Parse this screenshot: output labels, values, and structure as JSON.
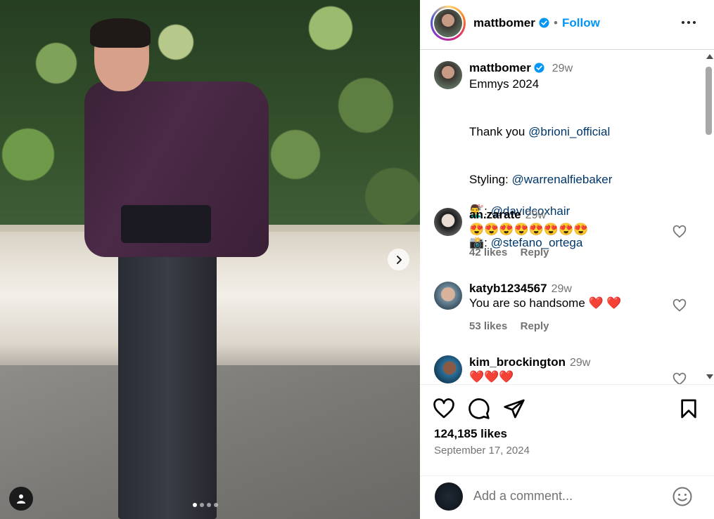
{
  "post": {
    "username": "mattbomer",
    "follow_label": "Follow",
    "separator": "•",
    "verified_color": "#0095f6"
  },
  "media": {
    "carousel_count": 4,
    "active_index": 0
  },
  "caption": {
    "username": "mattbomer",
    "time": "29w",
    "line1": "Emmys 2024",
    "thanks_prefix": "Thank you ",
    "thanks_mention": "@brioni_official",
    "styling_prefix": "Styling: ",
    "styling_mention": "@warrenalfiebaker",
    "hair_prefix": "💇‍♂️: ",
    "hair_mention": "@davidcoxhair",
    "photo_prefix": "📸: ",
    "photo_mention": "@stefano_ortega"
  },
  "comments": [
    {
      "username": "an.zarate",
      "time": "29w",
      "text": "😍😍😍😍😍😍😍😍",
      "likes": "42 likes",
      "reply": "Reply"
    },
    {
      "username": "katyb1234567",
      "time": "29w",
      "text": "You are so handsome ❤️ ❤️",
      "likes": "53 likes",
      "reply": "Reply"
    },
    {
      "username": "kim_brockington",
      "time": "29w",
      "text": "❤️❤️❤️"
    }
  ],
  "stats": {
    "likes": "124,185 likes",
    "date": "September 17, 2024"
  },
  "composer": {
    "placeholder": "Add a comment..."
  },
  "icons": [
    "verified-badge-icon",
    "more-options-icon",
    "like-icon",
    "comment-icon",
    "share-icon",
    "save-icon",
    "emoji-icon",
    "next-arrow-icon",
    "user-tag-icon"
  ]
}
